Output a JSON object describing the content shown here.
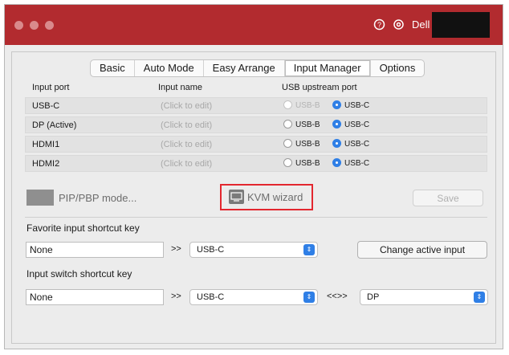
{
  "titlebar": {
    "title": "Dell",
    "help_icon": "question-circle-icon",
    "settings_icon": "gear-icon"
  },
  "tabs": [
    {
      "label": "Basic"
    },
    {
      "label": "Auto Mode"
    },
    {
      "label": "Easy Arrange"
    },
    {
      "label": "Input Manager",
      "active": true
    },
    {
      "label": "Options"
    }
  ],
  "table": {
    "headers": {
      "port": "Input port",
      "name": "Input name",
      "usb": "USB upstream port"
    },
    "rows": [
      {
        "port": "USB-C",
        "name": "(Click to edit)",
        "usb_b": "USB-B",
        "usb_c": "USB-C",
        "selected": "USB-C",
        "usb_b_disabled": true
      },
      {
        "port": "DP (Active)",
        "name": "(Click to edit)",
        "usb_b": "USB-B",
        "usb_c": "USB-C",
        "selected": "USB-C"
      },
      {
        "port": "HDMI1",
        "name": "(Click to edit)",
        "usb_b": "USB-B",
        "usb_c": "USB-C",
        "selected": "USB-C"
      },
      {
        "port": "HDMI2",
        "name": "(Click to edit)",
        "usb_b": "USB-B",
        "usb_c": "USB-C",
        "selected": "USB-C"
      }
    ]
  },
  "pip": {
    "label": "PIP/PBP mode..."
  },
  "kvm": {
    "label": "KVM wizard",
    "icon": "kvm-switch-icon"
  },
  "save": {
    "label": "Save"
  },
  "favorite": {
    "label": "Favorite input shortcut key",
    "key_value": "None",
    "arrow": ">>",
    "target": "USB-C",
    "change_button": "Change active input"
  },
  "switch": {
    "label": "Input switch shortcut key",
    "key_value": "None",
    "arrow": ">>",
    "target1": "USB-C",
    "between": "<<>>",
    "target2": "DP"
  },
  "colors": {
    "titlebar": "#b22b2f",
    "accent": "#2f7fe6",
    "highlight": "#e3272f"
  }
}
